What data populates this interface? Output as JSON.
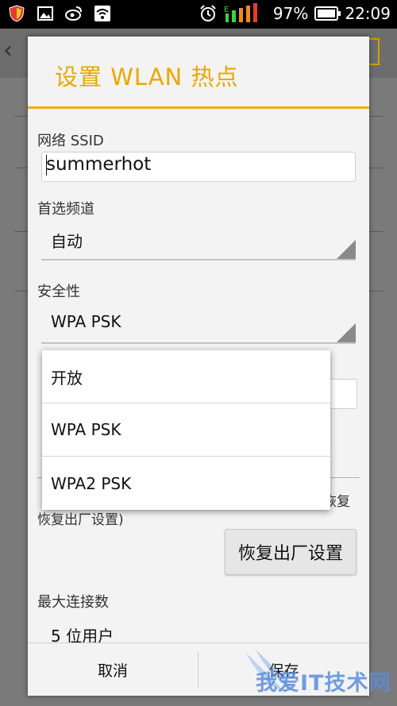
{
  "status_bar": {
    "battery_percent": 97,
    "battery_text": "97%",
    "time": "22:09",
    "signal_label": "E",
    "icons": [
      "security-shield-icon",
      "gallery-icon",
      "weibo-icon",
      "wifi-hotspot-icon",
      "alarm-icon",
      "signal-icon",
      "battery-icon"
    ]
  },
  "dialog": {
    "title": "设置 WLAN 热点",
    "ssid_label": "网络 SSID",
    "ssid_value": "summerhot",
    "channel_label": "首选频道",
    "channel_value": "自动",
    "security_label": "安全性",
    "security_value": "WPA PSK",
    "reset_description": "恢复出厂设置)",
    "reset_description_fragment": "恢复",
    "reset_button": "恢复出厂设置",
    "max_conn_label": "最大连接数",
    "max_conn_value": "5 位用户",
    "cancel_button": "取消",
    "save_button": "保存"
  },
  "security_popup": {
    "options": [
      "开放",
      "WPA PSK",
      "WPA2 PSK"
    ]
  },
  "colors": {
    "accent": "#e9a800",
    "dialog_bg": "#f3f3f3",
    "scrim": "#7a7a7a"
  },
  "watermark": {
    "text": "我爱IT技术网"
  }
}
